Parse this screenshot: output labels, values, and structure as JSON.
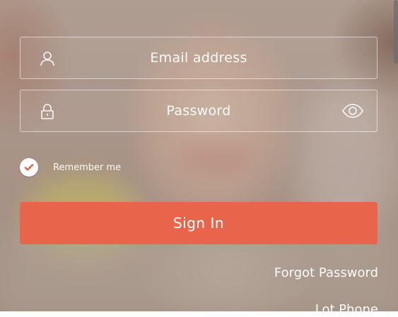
{
  "form": {
    "email": {
      "placeholder": "Email address",
      "icon": "user-icon"
    },
    "password": {
      "placeholder": "Password",
      "icon": "lock-icon",
      "toggle_icon": "eye-icon"
    },
    "remember": {
      "label": "Remember me",
      "checked": true
    },
    "sign_in_label": "Sign In",
    "forgot_label": "Forgot Password",
    "partial_link_label": "Lot Phone"
  },
  "colors": {
    "accent": "#e8644a",
    "check": "#e8644a",
    "text": "#ffffff"
  }
}
